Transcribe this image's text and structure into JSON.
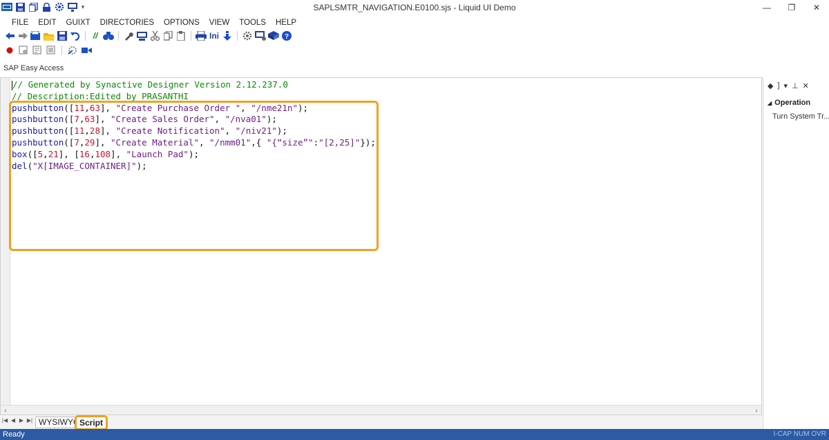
{
  "window": {
    "title": "SAPLSMTR_NAVIGATION.E0100.sjs - Liquid UI Demo",
    "minimize": "—",
    "restore": "❐",
    "close": "✕"
  },
  "menu": [
    "FILE",
    "EDIT",
    "GUIXT",
    "DIRECTORIES",
    "OPTIONS",
    "VIEW",
    "TOOLS",
    "HELP"
  ],
  "toolbar": {
    "ini_label": "Ini"
  },
  "screen_title": "SAP Easy Access",
  "editor": {
    "lines": [
      [
        {
          "t": "// Generated by Synactive Designer Version 2.12.237.0",
          "c": "c-comment"
        }
      ],
      [
        {
          "t": "// Description:Edited by PRASANTHI",
          "c": "c-comment"
        }
      ],
      [
        {
          "t": "pushbutton",
          "c": "c-kw"
        },
        {
          "t": "([",
          "c": "c-punc"
        },
        {
          "t": "11",
          "c": "c-num"
        },
        {
          "t": ",",
          "c": "c-punc"
        },
        {
          "t": "63",
          "c": "c-num"
        },
        {
          "t": "], ",
          "c": "c-punc"
        },
        {
          "t": "\"Create Purchase Order \"",
          "c": "c-str"
        },
        {
          "t": ", ",
          "c": "c-punc"
        },
        {
          "t": "\"/nme21n\"",
          "c": "c-str"
        },
        {
          "t": ");",
          "c": "c-punc"
        }
      ],
      [
        {
          "t": "pushbutton",
          "c": "c-kw"
        },
        {
          "t": "([",
          "c": "c-punc"
        },
        {
          "t": "7",
          "c": "c-num"
        },
        {
          "t": ",",
          "c": "c-punc"
        },
        {
          "t": "63",
          "c": "c-num"
        },
        {
          "t": "], ",
          "c": "c-punc"
        },
        {
          "t": "\"Create Sales Order\"",
          "c": "c-str"
        },
        {
          "t": ", ",
          "c": "c-punc"
        },
        {
          "t": "\"/nva01\"",
          "c": "c-str"
        },
        {
          "t": ");",
          "c": "c-punc"
        }
      ],
      [
        {
          "t": "pushbutton",
          "c": "c-kw"
        },
        {
          "t": "([",
          "c": "c-punc"
        },
        {
          "t": "11",
          "c": "c-num"
        },
        {
          "t": ",",
          "c": "c-punc"
        },
        {
          "t": "28",
          "c": "c-num"
        },
        {
          "t": "], ",
          "c": "c-punc"
        },
        {
          "t": "\"Create Notification\"",
          "c": "c-str"
        },
        {
          "t": ", ",
          "c": "c-punc"
        },
        {
          "t": "\"/niv21\"",
          "c": "c-str"
        },
        {
          "t": ");",
          "c": "c-punc"
        }
      ],
      [
        {
          "t": "pushbutton",
          "c": "c-kw"
        },
        {
          "t": "([",
          "c": "c-punc"
        },
        {
          "t": "7",
          "c": "c-num"
        },
        {
          "t": ",",
          "c": "c-punc"
        },
        {
          "t": "29",
          "c": "c-num"
        },
        {
          "t": "], ",
          "c": "c-punc"
        },
        {
          "t": "\"Create Material\"",
          "c": "c-str"
        },
        {
          "t": ", ",
          "c": "c-punc"
        },
        {
          "t": "\"/nmm01\"",
          "c": "c-str"
        },
        {
          "t": ",{ ",
          "c": "c-punc"
        },
        {
          "t": "\"{“size”\"",
          "c": "c-str"
        },
        {
          "t": ":",
          "c": "c-punc"
        },
        {
          "t": "\"[2,25]\"",
          "c": "c-str"
        },
        {
          "t": "});",
          "c": "c-punc"
        }
      ],
      [
        {
          "t": "box",
          "c": "c-kw"
        },
        {
          "t": "([",
          "c": "c-punc"
        },
        {
          "t": "5",
          "c": "c-num"
        },
        {
          "t": ",",
          "c": "c-punc"
        },
        {
          "t": "21",
          "c": "c-num"
        },
        {
          "t": "], [",
          "c": "c-punc"
        },
        {
          "t": "16",
          "c": "c-num"
        },
        {
          "t": ",",
          "c": "c-punc"
        },
        {
          "t": "108",
          "c": "c-num"
        },
        {
          "t": "], ",
          "c": "c-punc"
        },
        {
          "t": "\"Launch Pad\"",
          "c": "c-str"
        },
        {
          "t": ");",
          "c": "c-punc"
        }
      ],
      [
        {
          "t": "del",
          "c": "c-kw"
        },
        {
          "t": "(",
          "c": "c-punc"
        },
        {
          "t": "\"X[IMAGE_CONTAINER]\"",
          "c": "c-str"
        },
        {
          "t": ");",
          "c": "c-punc"
        }
      ]
    ]
  },
  "tabs": {
    "wysiwyg": "WYSIWYG",
    "script": "Script"
  },
  "right_panel": {
    "section": "Operation",
    "item": "Turn System Tr..."
  },
  "status": {
    "left": "Ready",
    "right": "I-CAP NUM OVR"
  },
  "colors": {
    "highlight": "#f0a020",
    "statusbar": "#2c5aa3",
    "comment": "#0a8a0a"
  }
}
